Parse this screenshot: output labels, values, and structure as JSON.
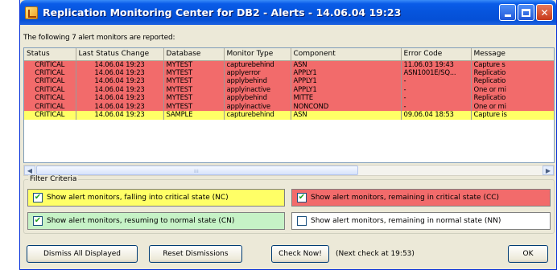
{
  "window": {
    "title": "Replication Monitoring Center for DB2 - Alerts - 14.06.04 19:23"
  },
  "info_text": "The following 7 alert monitors are reported:",
  "table": {
    "columns": [
      "Status",
      "Last Status Change",
      "Database",
      "Monitor Type",
      "Component",
      "Error Code",
      "Message"
    ],
    "rows": [
      {
        "severity": "critical",
        "cells": [
          "CRITICAL",
          "14.06.04 19:23",
          "MYTEST",
          "capturebehind",
          "ASN",
          "11.06.03 19:43",
          "Capture s"
        ]
      },
      {
        "severity": "critical",
        "cells": [
          "CRITICAL",
          "14.06.04 19:23",
          "MYTEST",
          "applyerror",
          "APPLY1",
          "ASN1001E/SQ...",
          "Replicatio"
        ]
      },
      {
        "severity": "critical",
        "cells": [
          "CRITICAL",
          "14.06.04 19:23",
          "MYTEST",
          "applybehind",
          "APPLY1",
          "-",
          "Replicatio"
        ]
      },
      {
        "severity": "critical",
        "cells": [
          "CRITICAL",
          "14.06.04 19:23",
          "MYTEST",
          "applyinactive",
          "APPLY1",
          "-",
          "One or mi"
        ]
      },
      {
        "severity": "critical",
        "cells": [
          "CRITICAL",
          "14.06.04 19:23",
          "MYTEST",
          "applybehind",
          "MITTE",
          "-",
          "Replicatio"
        ]
      },
      {
        "severity": "critical",
        "cells": [
          "CRITICAL",
          "14.06.04 19:23",
          "MYTEST",
          "applyinactive",
          "NONCOND",
          "-",
          "One or mi"
        ]
      },
      {
        "severity": "warning",
        "cells": [
          "CRITICAL",
          "14.06.04 19:23",
          "SAMPLE",
          "capturebehind",
          "ASN",
          "09.06.04 18:53",
          "Capture is"
        ]
      }
    ]
  },
  "filter": {
    "legend": "Filter Criteria",
    "nc": {
      "label": "Show alert monitors, falling into critical state (NC)",
      "checked": true,
      "color": "#ffff66"
    },
    "cc": {
      "label": "Show alert monitors, remaining in critical state (CC)",
      "checked": true,
      "color": "#f26b6b"
    },
    "cn": {
      "label": "Show alert monitors, resuming to normal state (CN)",
      "checked": true,
      "color": "#c6f2c6"
    },
    "nn": {
      "label": "Show alert monitors, remaining in normal state (NN)",
      "checked": false,
      "color": "#ffffff"
    }
  },
  "buttons": {
    "dismiss_all": "Dismiss All Displayed",
    "reset": "Reset Dismissions",
    "check_now": "Check Now!",
    "ok": "OK"
  },
  "next_check": "(Next check at 19:53)"
}
